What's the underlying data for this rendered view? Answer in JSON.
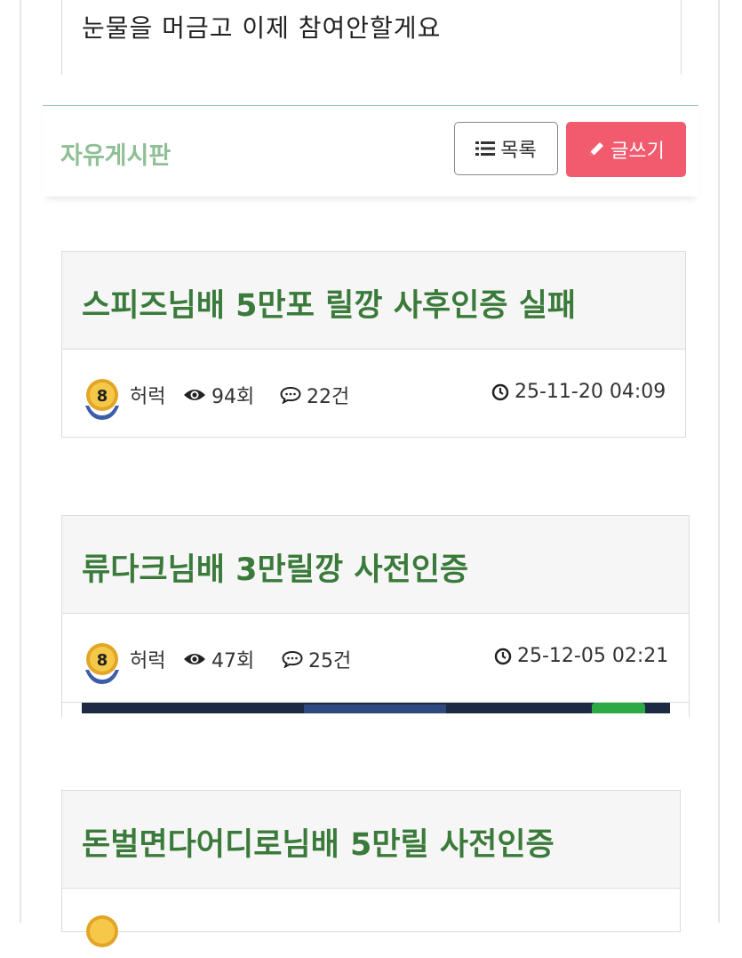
{
  "top_comment": {
    "text": "눈물을 머금고 이제 참여안할게요"
  },
  "board": {
    "title": "자유게시판",
    "list_button": "목록",
    "write_button": "글쓰기",
    "accent_color": "#f25a6e",
    "title_color": "#8fbf94"
  },
  "posts": [
    {
      "title": "스피즈님배 5만포 릴깡 사후인증 실패",
      "author": "허럭",
      "level": "8",
      "views": "94회",
      "comments": "22건",
      "date": "25-11-20 04:09"
    },
    {
      "title": "류다크님배 3만릴깡 사전인증",
      "author": "허럭",
      "level": "8",
      "views": "47회",
      "comments": "25건",
      "date": "25-12-05 02:21"
    },
    {
      "title": "돈벌면다어디로님배 5만릴 사전인증"
    }
  ],
  "icons": [
    "list-icon",
    "pencil-icon",
    "eye-icon",
    "comment-icon",
    "clock-icon",
    "level-badge-icon"
  ]
}
